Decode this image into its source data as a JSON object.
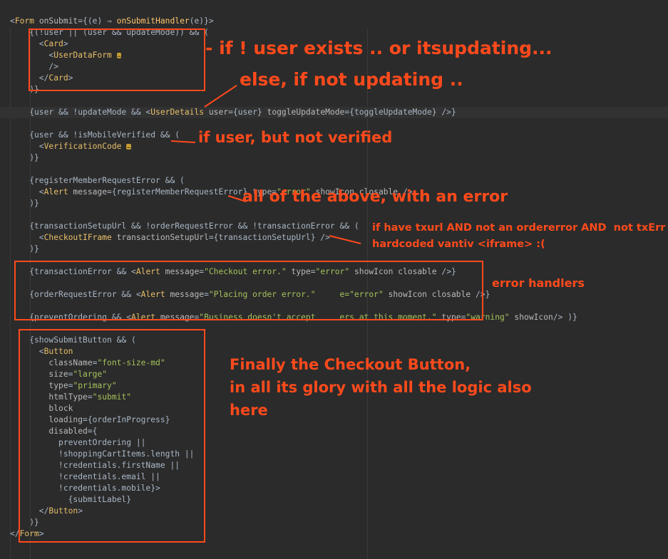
{
  "code": [
    {
      "segments": [
        {
          "c": "t-pl",
          "t": "<"
        },
        {
          "c": "t-tag",
          "t": "Form "
        },
        {
          "c": "t-attr",
          "t": "onSubmit"
        },
        {
          "c": "t-pl",
          "t": "={(e) ⇒ "
        },
        {
          "c": "t-fn",
          "t": "onSubmitHandler"
        },
        {
          "c": "t-pl",
          "t": "(e)}>"
        }
      ]
    },
    {
      "segments": [
        {
          "c": "t-pl",
          "t": "    {(!user || (user && updateMode)) && ("
        }
      ]
    },
    {
      "segments": [
        {
          "c": "t-pl",
          "t": "      <"
        },
        {
          "c": "t-tag",
          "t": "Card"
        },
        {
          "c": "t-pl",
          "t": ">"
        }
      ]
    },
    {
      "segments": [
        {
          "c": "t-pl",
          "t": "        <"
        },
        {
          "c": "t-tag",
          "t": "UserDataForm "
        }
      ],
      "fold": "…"
    },
    {
      "segments": [
        {
          "c": "t-pl",
          "t": "        />"
        }
      ]
    },
    {
      "segments": [
        {
          "c": "t-pl",
          "t": "      </"
        },
        {
          "c": "t-tag",
          "t": "Card"
        },
        {
          "c": "t-pl",
          "t": ">"
        }
      ]
    },
    {
      "segments": [
        {
          "c": "t-pl",
          "t": "    )}"
        }
      ]
    },
    {
      "segments": []
    },
    {
      "segments": [
        {
          "c": "t-pl",
          "t": "    {user && !updateMode && <"
        },
        {
          "c": "t-tag",
          "t": "UserDetails "
        },
        {
          "c": "t-attr",
          "t": "user"
        },
        {
          "c": "t-pl",
          "t": "={user} "
        },
        {
          "c": "t-attr",
          "t": "toggleUpdateMode"
        },
        {
          "c": "t-pl",
          "t": "={toggleUpdateMode} />}"
        }
      ]
    },
    {
      "segments": []
    },
    {
      "segments": [
        {
          "c": "t-pl",
          "t": "    {user && !isMobileVerified && ("
        }
      ]
    },
    {
      "segments": [
        {
          "c": "t-pl",
          "t": "      <"
        },
        {
          "c": "t-tag",
          "t": "VerificationCode "
        }
      ],
      "fold": "…"
    },
    {
      "segments": [
        {
          "c": "t-pl",
          "t": "    )}"
        }
      ]
    },
    {
      "segments": []
    },
    {
      "segments": [
        {
          "c": "t-pl",
          "t": "    {registerMemberRequestError && ("
        }
      ]
    },
    {
      "segments": [
        {
          "c": "t-pl",
          "t": "      <"
        },
        {
          "c": "t-tag",
          "t": "Alert "
        },
        {
          "c": "t-attr",
          "t": "message"
        },
        {
          "c": "t-pl",
          "t": "={registerMemberRequestError} "
        },
        {
          "c": "t-attr",
          "t": "type"
        },
        {
          "c": "t-pl",
          "t": "="
        },
        {
          "c": "t-str",
          "t": "\"error\""
        },
        {
          "c": "t-pl",
          "t": " "
        },
        {
          "c": "t-attr",
          "t": "showIcon closable "
        },
        {
          "c": "t-pl",
          "t": "/>"
        }
      ]
    },
    {
      "segments": [
        {
          "c": "t-pl",
          "t": "    )}"
        }
      ]
    },
    {
      "segments": []
    },
    {
      "segments": [
        {
          "c": "t-pl",
          "t": "    {transactionSetupUrl && !orderRequestError && !transactionError && ("
        }
      ]
    },
    {
      "segments": [
        {
          "c": "t-pl",
          "t": "      <"
        },
        {
          "c": "t-tag",
          "t": "CheckoutIFrame "
        },
        {
          "c": "t-attr",
          "t": "transactionSetupUrl"
        },
        {
          "c": "t-pl",
          "t": "={transactionSetupUrl} />"
        }
      ]
    },
    {
      "segments": [
        {
          "c": "t-pl",
          "t": "    )}"
        }
      ]
    },
    {
      "segments": []
    },
    {
      "segments": [
        {
          "c": "t-pl",
          "t": "    {transactionError && <"
        },
        {
          "c": "t-tag",
          "t": "Alert "
        },
        {
          "c": "t-attr",
          "t": "message"
        },
        {
          "c": "t-pl",
          "t": "="
        },
        {
          "c": "t-str",
          "t": "\"Checkout error.\""
        },
        {
          "c": "t-pl",
          "t": " "
        },
        {
          "c": "t-attr",
          "t": "type"
        },
        {
          "c": "t-pl",
          "t": "="
        },
        {
          "c": "t-str",
          "t": "\"error\""
        },
        {
          "c": "t-pl",
          "t": " "
        },
        {
          "c": "t-attr",
          "t": "showIcon closable "
        },
        {
          "c": "t-pl",
          "t": "/>}"
        }
      ]
    },
    {
      "segments": []
    },
    {
      "segments": [
        {
          "c": "t-pl",
          "t": "    {orderRequestError && <"
        },
        {
          "c": "t-tag",
          "t": "Alert "
        },
        {
          "c": "t-attr",
          "t": "message"
        },
        {
          "c": "t-pl",
          "t": "="
        },
        {
          "c": "t-str",
          "t": "\"Placing order error.\""
        },
        {
          "c": "t-pl",
          "t": "     "
        },
        {
          "c": "t-str",
          "t": "e=\"error\""
        },
        {
          "c": "t-pl",
          "t": " "
        },
        {
          "c": "t-attr",
          "t": "showIcon closable "
        },
        {
          "c": "t-pl",
          "t": "/>}"
        }
      ]
    },
    {
      "segments": []
    },
    {
      "segments": [
        {
          "c": "t-pl",
          "t": "    {preventOrdering && <"
        },
        {
          "c": "t-tag",
          "t": "Alert "
        },
        {
          "c": "t-attr",
          "t": "message"
        },
        {
          "c": "t-pl",
          "t": "="
        },
        {
          "c": "t-str",
          "t": "\"Business doesn't accept     ers at this moment.\""
        },
        {
          "c": "t-pl",
          "t": " "
        },
        {
          "c": "t-attr",
          "t": "type"
        },
        {
          "c": "t-pl",
          "t": "="
        },
        {
          "c": "t-str",
          "t": "\"warning\""
        },
        {
          "c": "t-pl",
          "t": " "
        },
        {
          "c": "t-attr",
          "t": "showIcon"
        },
        {
          "c": "t-pl",
          "t": "/> )}"
        }
      ]
    },
    {
      "segments": []
    },
    {
      "segments": [
        {
          "c": "t-pl",
          "t": "    {showSubmitButton && ("
        }
      ]
    },
    {
      "segments": [
        {
          "c": "t-pl",
          "t": "      <"
        },
        {
          "c": "t-tag",
          "t": "Button"
        }
      ]
    },
    {
      "segments": [
        {
          "c": "t-attr",
          "t": "        className"
        },
        {
          "c": "t-pl",
          "t": "="
        },
        {
          "c": "t-str",
          "t": "\"font-size-md\""
        }
      ]
    },
    {
      "segments": [
        {
          "c": "t-attr",
          "t": "        size"
        },
        {
          "c": "t-pl",
          "t": "="
        },
        {
          "c": "t-str",
          "t": "\"large\""
        }
      ]
    },
    {
      "segments": [
        {
          "c": "t-attr",
          "t": "        type"
        },
        {
          "c": "t-pl",
          "t": "="
        },
        {
          "c": "t-str",
          "t": "\"primary\""
        }
      ]
    },
    {
      "segments": [
        {
          "c": "t-attr",
          "t": "        htmlType"
        },
        {
          "c": "t-pl",
          "t": "="
        },
        {
          "c": "t-str",
          "t": "\"submit\""
        }
      ]
    },
    {
      "segments": [
        {
          "c": "t-attr",
          "t": "        block"
        }
      ]
    },
    {
      "segments": [
        {
          "c": "t-attr",
          "t": "        loading"
        },
        {
          "c": "t-pl",
          "t": "={orderInProgress}"
        }
      ]
    },
    {
      "segments": [
        {
          "c": "t-attr",
          "t": "        disabled"
        },
        {
          "c": "t-pl",
          "t": "={"
        }
      ]
    },
    {
      "segments": [
        {
          "c": "t-pl",
          "t": "          preventOrdering ||"
        }
      ]
    },
    {
      "segments": [
        {
          "c": "t-pl",
          "t": "          !shoppingCartItems.length ||"
        }
      ]
    },
    {
      "segments": [
        {
          "c": "t-pl",
          "t": "          !credentials.firstName ||"
        }
      ]
    },
    {
      "segments": [
        {
          "c": "t-pl",
          "t": "          !credentials.email ||"
        }
      ]
    },
    {
      "segments": [
        {
          "c": "t-pl",
          "t": "          !credentials.mobile}>"
        }
      ]
    },
    {
      "segments": [
        {
          "c": "t-pl",
          "t": "            {submitLabel}"
        }
      ]
    },
    {
      "segments": [
        {
          "c": "t-pl",
          "t": "      </"
        },
        {
          "c": "t-tag",
          "t": "Button"
        },
        {
          "c": "t-pl",
          "t": ">"
        }
      ]
    },
    {
      "segments": [
        {
          "c": "t-pl",
          "t": "    )}"
        }
      ]
    },
    {
      "segments": [
        {
          "c": "t-pl",
          "t": "</"
        },
        {
          "c": "t-tag",
          "t": "Form"
        },
        {
          "c": "t-pl",
          "t": ">"
        }
      ]
    }
  ],
  "annotations": {
    "user_exists": "- if ! user exists .. or itsupdating...",
    "not_updating": "else, if not updating ..",
    "not_verified": "if user, but not verified",
    "all_above": "all of the above, with an error",
    "txurl_line1": "if have txurl AND not an ordererror AND  not txErr",
    "txurl_line2": "hardcoded vantiv <iframe> :(",
    "error_handlers": "error handlers",
    "checkout_line1": "Finally the Checkout Button,",
    "checkout_line2": "in all its glory with all the logic also",
    "checkout_line3": "here"
  },
  "colors": {
    "background": "#2b2b2b",
    "annotation": "#ff4a1c",
    "tag": "#e8bf6a",
    "string": "#a5c25c",
    "attribute": "#bababa",
    "text": "#a9b7c6"
  }
}
